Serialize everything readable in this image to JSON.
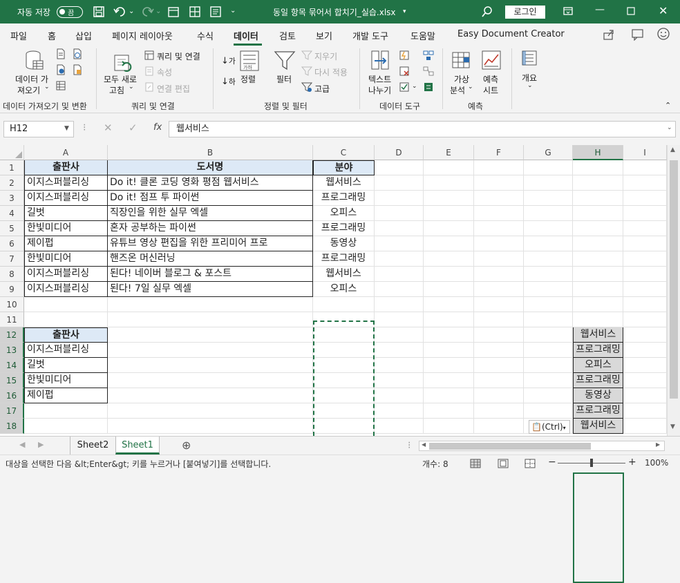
{
  "titlebar": {
    "autosave_label": "자동 저장",
    "autosave_state": "끔",
    "filename": "동일 항목 묶어서 합치기_실습.xlsx",
    "login": "로그인",
    "accent": "#217346"
  },
  "tabs": [
    "파일",
    "홈",
    "삽입",
    "페이지 레이아웃",
    "수식",
    "데이터",
    "검토",
    "보기",
    "개발 도구",
    "도움말",
    "Easy Document Creator"
  ],
  "active_tab": "데이터",
  "ribbon": {
    "get_data": {
      "line1": "데이터 가",
      "line2": "져오기",
      "group": "데이터 가져오기 및 변환"
    },
    "queries": {
      "refresh1": "모두 새로",
      "refresh2": "고침",
      "queries_conn": "쿼리 및 연결",
      "properties": "속성",
      "edit_links": "연결 편집",
      "group": "쿼리 및 연결"
    },
    "sort": {
      "sort": "정렬",
      "filter": "필터",
      "clear": "지우기",
      "reapply": "다시 적용",
      "advanced": "고급",
      "group": "정렬 및 필터"
    },
    "tools": {
      "text1": "텍스트",
      "text2": "나누기",
      "group": "데이터 도구"
    },
    "forecast": {
      "whatif1": "가상",
      "whatif2": "분석",
      "sheet1": "예측",
      "sheet2": "시트",
      "group": "예측"
    },
    "outline": {
      "label": "개요"
    }
  },
  "formula_bar": {
    "name_box": "H12",
    "formula": "웹서비스",
    "fx": "fx"
  },
  "columns": [
    "A",
    "B",
    "C",
    "D",
    "E",
    "F",
    "G",
    "H",
    "I"
  ],
  "rows": [
    "1",
    "2",
    "3",
    "4",
    "5",
    "6",
    "7",
    "8",
    "9",
    "10",
    "11",
    "12",
    "13",
    "14",
    "15",
    "16",
    "17",
    "18"
  ],
  "table1": {
    "headers": [
      "출판사",
      "도서명",
      "분야"
    ],
    "rows": [
      [
        "이지스퍼블리싱",
        "Do it! 클론 코딩 영화 평점 웹서비스",
        "웹서비스"
      ],
      [
        "이지스퍼블리싱",
        "Do it! 점프 투 파이썬",
        "프로그래밍"
      ],
      [
        "길벗",
        "직장인을 위한 실무 엑셀",
        "오피스"
      ],
      [
        "한빛미디어",
        "혼자 공부하는 파이썬",
        "프로그래밍"
      ],
      [
        "제이펍",
        "유튜브 영상 편집을 위한 프리미어 프로",
        "동영상"
      ],
      [
        "한빛미디어",
        "핸즈온 머신러닝",
        "프로그래밍"
      ],
      [
        "이지스퍼블리싱",
        "된다! 네이버 블로그 & 포스트",
        "웹서비스"
      ],
      [
        "이지스퍼블리싱",
        "된다! 7일 실무 엑셀",
        "오피스"
      ]
    ]
  },
  "table2": {
    "header": "출판사",
    "rows": [
      "이지스퍼블리싱",
      "길벗",
      "한빛미디어",
      "제이펍"
    ]
  },
  "pasted_h": [
    "웹서비스",
    "프로그래밍",
    "오피스",
    "프로그래밍",
    "동영상",
    "프로그래밍",
    "웹서비스"
  ],
  "paste_options": "(Ctrl)",
  "sheets": [
    "Sheet2",
    "Sheet1"
  ],
  "active_sheet": "Sheet1",
  "status": {
    "message": "대상을 선택한 다음 &lt;Enter&gt; 키를 누르거나 [붙여넣기]를 선택합니다.",
    "count": "개수: 8",
    "zoom": "100%"
  }
}
